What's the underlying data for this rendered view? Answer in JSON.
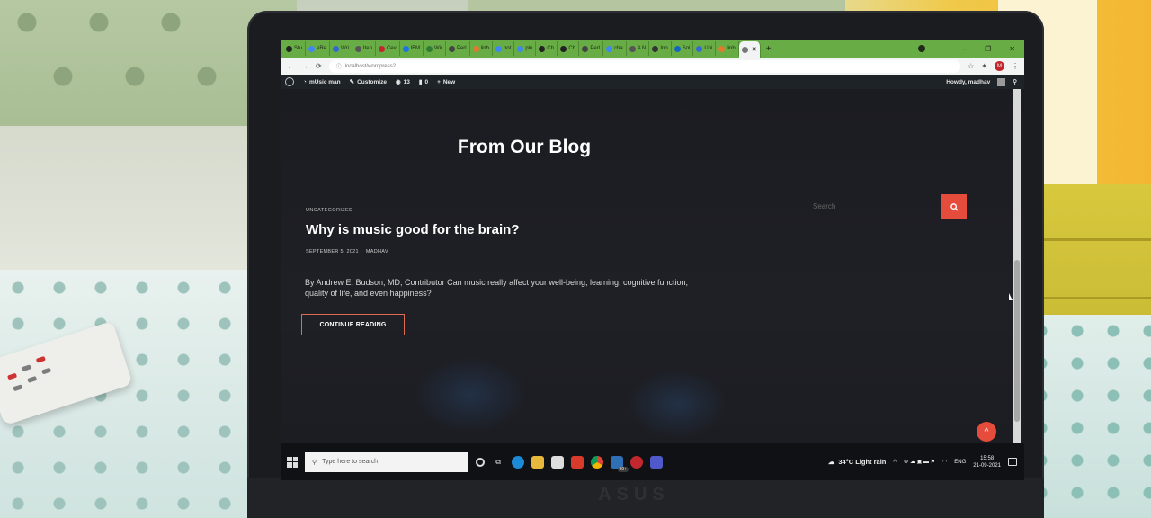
{
  "browser": {
    "tabs": [
      {
        "label": "Stu",
        "icon": "github-icon"
      },
      {
        "label": "eRe",
        "icon": "google-icon"
      },
      {
        "label": "Wri",
        "icon": "document-icon"
      },
      {
        "label": "Iten",
        "icon": "gear-icon"
      },
      {
        "label": "Cev",
        "icon": "calendar-icon"
      },
      {
        "label": "IFM",
        "icon": "bookmark-icon"
      },
      {
        "label": "Wir",
        "icon": "leaf-icon"
      },
      {
        "label": "Perl",
        "icon": "window-icon"
      },
      {
        "label": "linb",
        "icon": "link-icon"
      },
      {
        "label": "pot",
        "icon": "google-icon"
      },
      {
        "label": "plu",
        "icon": "google-icon"
      },
      {
        "label": "Ch",
        "icon": "github-icon"
      },
      {
        "label": "Ch",
        "icon": "github-icon"
      },
      {
        "label": "Perl",
        "icon": "window-icon"
      },
      {
        "label": "cha",
        "icon": "google-icon"
      },
      {
        "label": "A N",
        "icon": "chat-icon"
      },
      {
        "label": "Ino",
        "icon": "n-icon"
      },
      {
        "label": "Sol",
        "icon": "square-icon"
      },
      {
        "label": "Uni",
        "icon": "document-icon"
      },
      {
        "label": "linb",
        "icon": "link-icon"
      }
    ],
    "url": "localhost/wordpress2"
  },
  "wp_admin": {
    "site_name": "mUsic man",
    "customize": "Customize",
    "updates_count": "13",
    "comments_count": "0",
    "new_label": "New",
    "howdy": "Howdy, madhav"
  },
  "page": {
    "heading": "From Our Blog",
    "post": {
      "category": "UNCATEGORIZED",
      "title": "Why is music good for the brain?",
      "date": "SEPTEMBER 5, 2021",
      "author": "MADHAV",
      "excerpt": "By Andrew E. Budson, MD, Contributor Can music really affect your well-being, learning, cognitive function, quality of life, and even happiness?",
      "cta": "CONTINUE READING"
    },
    "search_placeholder": "Search",
    "colors": {
      "accent": "#e64c3c",
      "background": "#1c1d22"
    }
  },
  "taskbar": {
    "search_placeholder": "Type here to search",
    "mail_badge": "99+",
    "weather": "34°C  Light rain",
    "language": "ENG",
    "time": "15:58",
    "date": "21-09-2021"
  },
  "laptop_brand": "ASUS"
}
